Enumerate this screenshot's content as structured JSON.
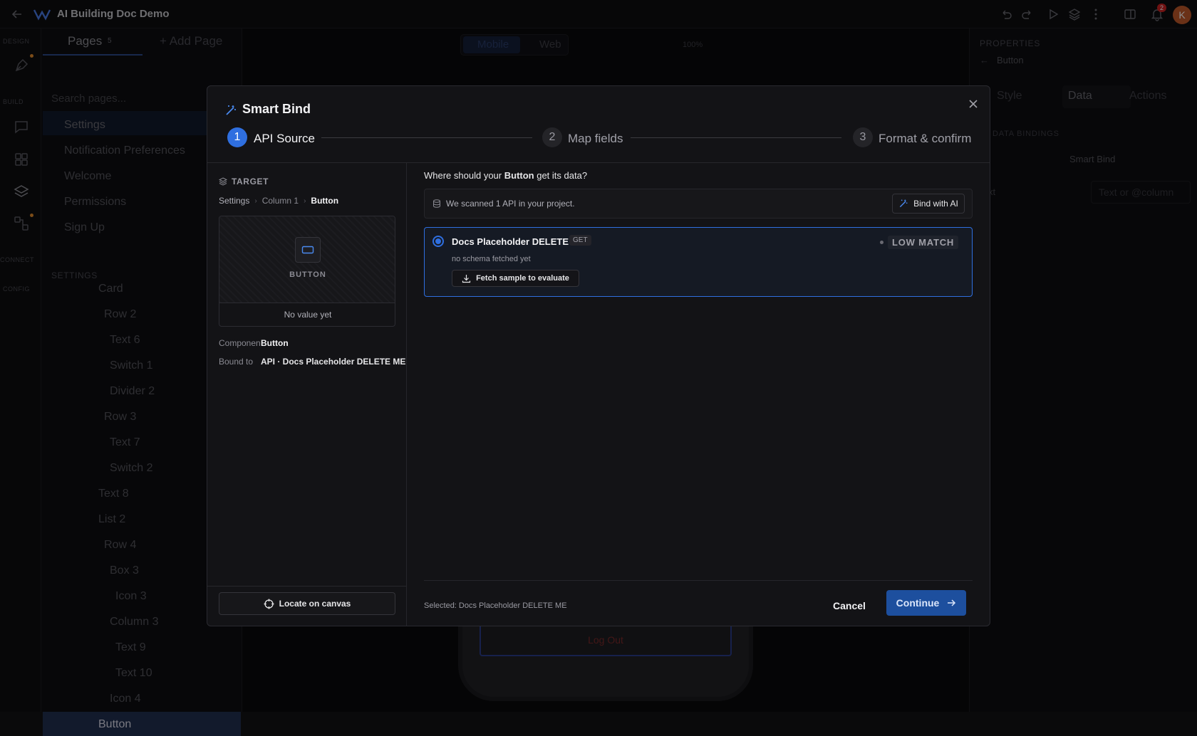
{
  "app": {
    "title": "AI Building Doc Demo",
    "notif_count": "2",
    "avatar_letter": "K"
  },
  "rail": {
    "design": "DESIGN",
    "build": "BUILD",
    "connect": "CONNECT",
    "config": "CONFIG"
  },
  "pages_panel": {
    "tab_pages": "Pages",
    "pages_count": "5",
    "add_page": "+ Add Page",
    "search_placeholder": "Search pages...",
    "pages": [
      "Settings",
      "Notification Preferences",
      "Welcome",
      "Permissions",
      "Sign Up"
    ],
    "section_settings": "SETTINGS",
    "tree": [
      "Card",
      "Row 2",
      "Text 6",
      "Switch 1",
      "Divider 2",
      "Row 3",
      "Text 7",
      "Switch 2",
      "Text 8",
      "List 2",
      "Row 4",
      "Box 3",
      "Icon 3",
      "Column 3",
      "Text 9",
      "Text 10",
      "Icon 4",
      "Button"
    ]
  },
  "canvas": {
    "mobile": "Mobile",
    "web": "Web",
    "zoom": "100%",
    "logout_label": "Log Out"
  },
  "properties": {
    "header": "PROPERTIES",
    "back_label": "Button",
    "tabs": [
      "Style",
      "Data",
      "Actions"
    ],
    "data_bindings": "DATA BINDINGS",
    "smart_bind": "Smart Bind",
    "text_label": "xt",
    "text_placeholder": "Text or @column"
  },
  "modal": {
    "title": "Smart Bind",
    "steps": [
      {
        "num": "1",
        "label": "API Source"
      },
      {
        "num": "2",
        "label": "Map fields"
      },
      {
        "num": "3",
        "label": "Format & confirm"
      }
    ],
    "target": {
      "header": "TARGET",
      "breadcrumb": [
        "Settings",
        "Column 1",
        "Button"
      ],
      "preview_label": "BUTTON",
      "no_value": "No value yet",
      "component_key": "Componen",
      "component_val": "Button",
      "bound_key": "Bound to",
      "bound_val": "API · Docs Placeholder DELETE ME",
      "locate_label": "Locate on canvas"
    },
    "question_pre": "Where should your ",
    "question_bold": "Button",
    "question_post": " get its data?",
    "scanned": "We scanned 1 API in your project.",
    "bind_ai": "Bind with AI",
    "api": {
      "name": "Docs Placeholder DELETE ME",
      "method": "GET",
      "match": "LOW MATCH",
      "schema_note": "no schema fetched yet",
      "fetch_label": "Fetch sample to evaluate"
    },
    "selected_text": "Selected: Docs Placeholder DELETE ME",
    "cancel": "Cancel",
    "continue": "Continue"
  },
  "colors": {
    "accent": "#2f6fe0",
    "continue_bg": "#1d4f9e",
    "modal_bg": "#131316"
  }
}
